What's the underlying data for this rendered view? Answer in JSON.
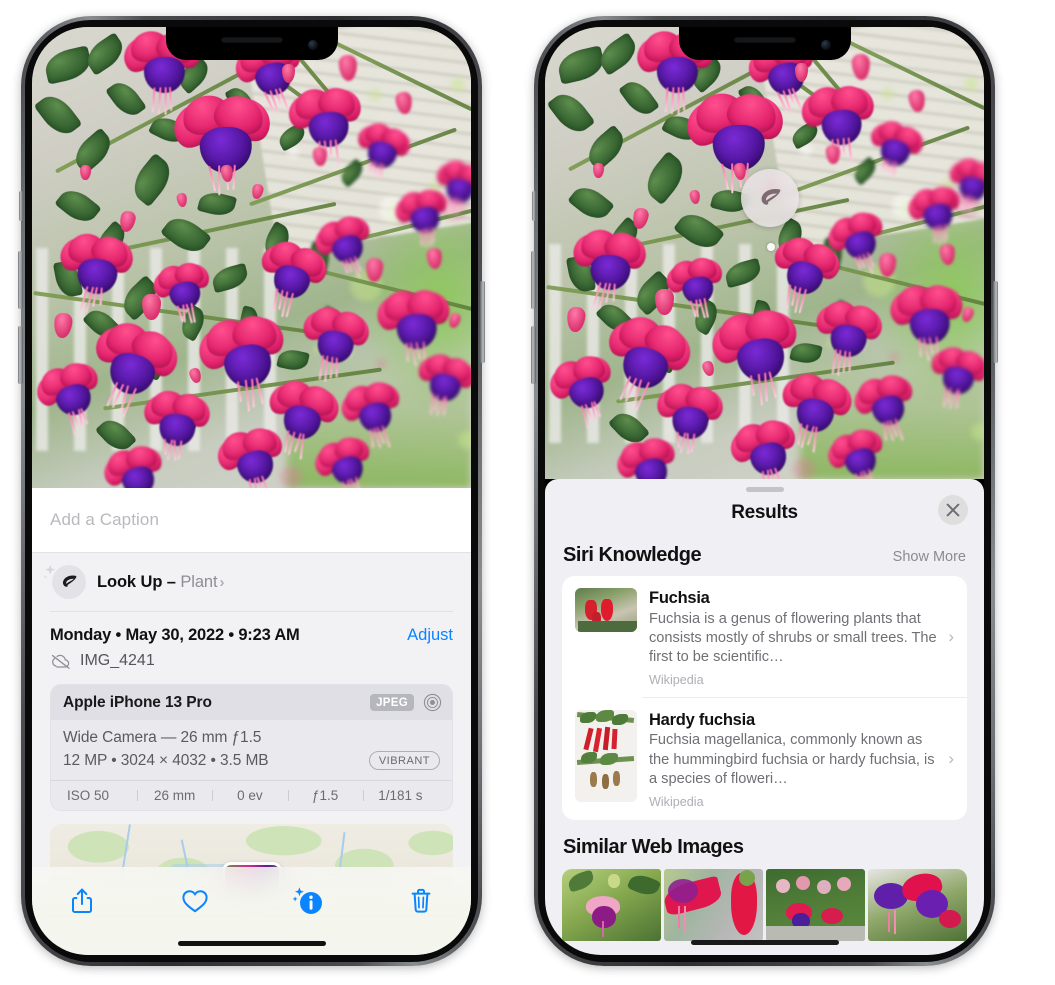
{
  "left_phone": {
    "caption_placeholder": "Add a Caption",
    "lookup": {
      "label": "Look Up – ",
      "subject": "Plant",
      "chevron": "›",
      "icon": "leaf-icon"
    },
    "meta": {
      "date": "Monday • May 30, 2022 • 9:23 AM",
      "adjust_label": "Adjust",
      "filename": "IMG_4241",
      "cloud_icon": "cloud-slash-icon"
    },
    "camera_card": {
      "device": "Apple iPhone 13 Pro",
      "format_badge": "JPEG",
      "lens_icon": "camera-lens-icon",
      "lens_line": "Wide Camera — 26 mm ƒ1.5",
      "specs_line": "12 MP • 3024 × 4032 • 3.5 MB",
      "style_badge": "VIBRANT",
      "exif": [
        "ISO 50",
        "26 mm",
        "0 ev",
        "ƒ1.5",
        "1/181 s"
      ]
    },
    "toolbar": [
      {
        "name": "share-icon",
        "label": "Share"
      },
      {
        "name": "heart-icon",
        "label": "Favorite"
      },
      {
        "name": "info-sparkle-icon",
        "label": "Info"
      },
      {
        "name": "trash-icon",
        "label": "Delete"
      }
    ]
  },
  "right_phone": {
    "visual_lookup_badge": {
      "icon": "leaf-icon"
    },
    "sheet": {
      "title": "Results",
      "close_icon": "close-icon",
      "sections": [
        {
          "title": "Siri Knowledge",
          "action": "Show More",
          "items": [
            {
              "title": "Fuchsia",
              "description": "Fuchsia is a genus of flowering plants that consists mostly of shrubs or small trees. The first to be scientific…",
              "source": "Wikipedia",
              "chevron": "›"
            },
            {
              "title": "Hardy fuchsia",
              "description": "Fuchsia magellanica, commonly known as the hummingbird fuchsia or hardy fuchsia, is a species of floweri…",
              "source": "Wikipedia",
              "chevron": "›"
            }
          ]
        },
        {
          "title": "Similar Web Images",
          "thumbnails": [
            "web-image-1",
            "web-image-2",
            "web-image-3",
            "web-image-4"
          ]
        }
      ]
    }
  },
  "colors": {
    "accent_blue": "#0a84ff",
    "sheet_bg": "#f2f2f5",
    "card_bg": "#e9e9ee",
    "results_bg": "#f0f0f4",
    "muted_text": "#8e8e93"
  }
}
